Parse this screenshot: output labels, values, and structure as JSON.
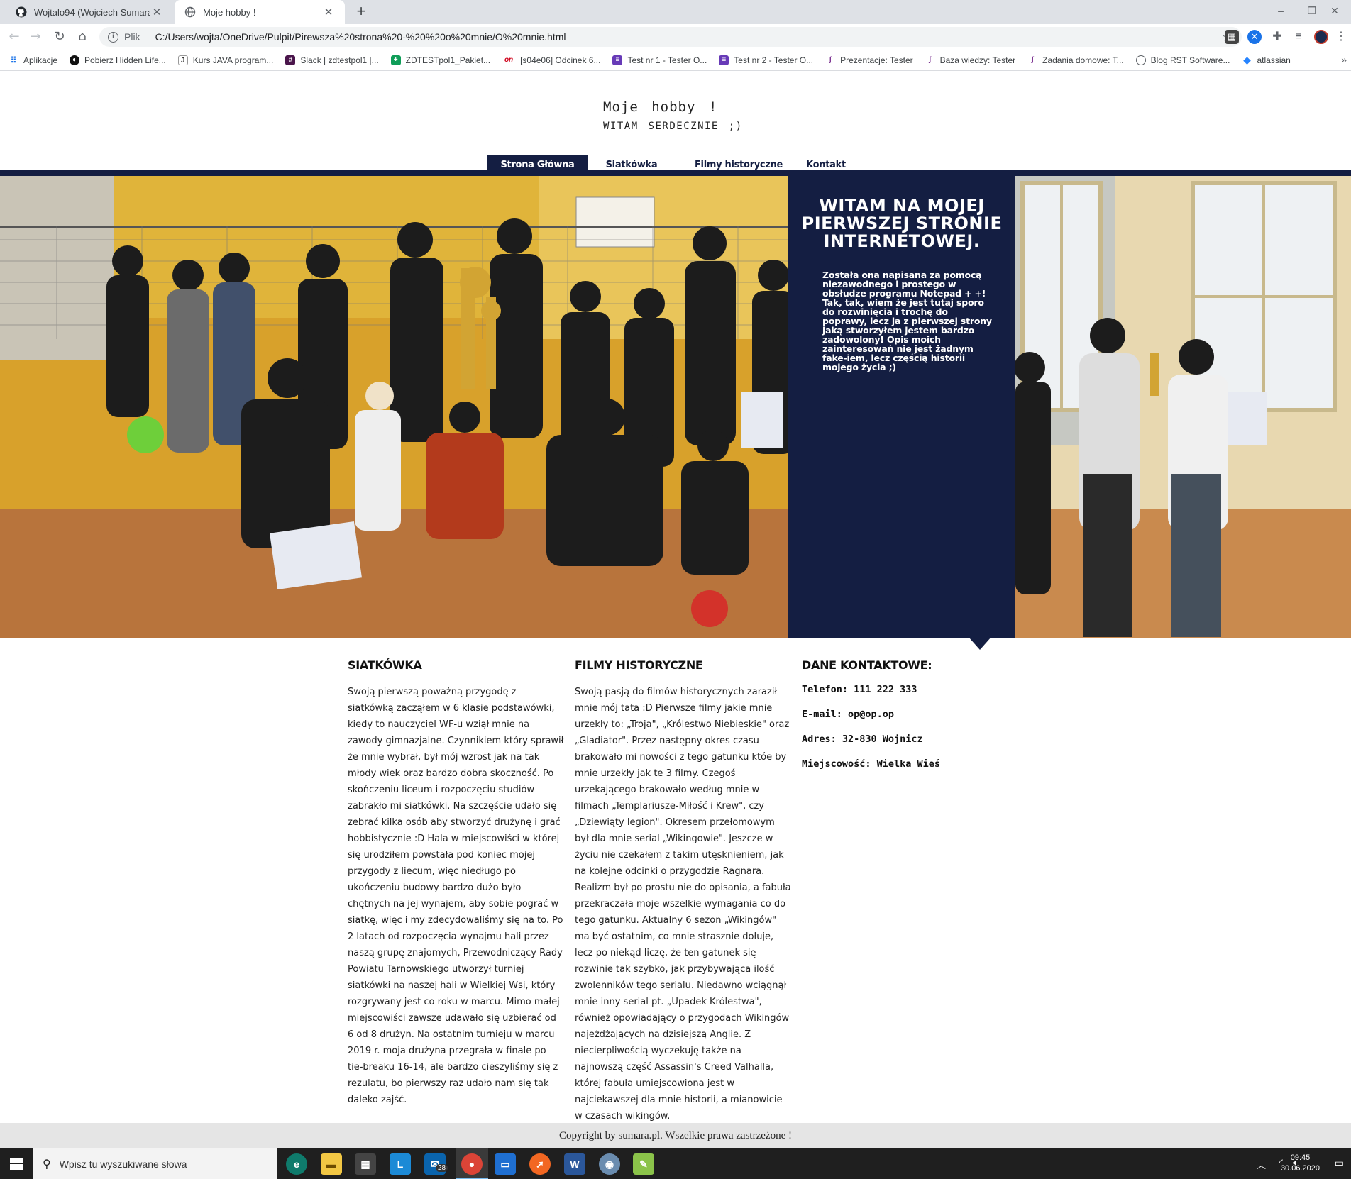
{
  "browser": {
    "tabs": [
      {
        "title": "Wojtalo94 (Wojciech Sumara)",
        "favicon": "github-icon",
        "active": false
      },
      {
        "title": "Moje hobby !",
        "favicon": "globe-icon",
        "active": true
      }
    ],
    "new_tab": "+",
    "window_controls": {
      "minimize": "–",
      "maximize": "❐",
      "close": "✕"
    },
    "address": {
      "scheme": "Plik",
      "url": "C:/Users/wojta/OneDrive/Pulpit/Pirewsza%20strona%20-%20%20o%20mnie/O%20mnie.html"
    },
    "bookmarks": [
      {
        "label": "Aplikacje",
        "icon": "apps-grid-icon"
      },
      {
        "label": "Pobierz Hidden Life...",
        "icon": "hidden-life-icon"
      },
      {
        "label": "Kurs JAVA program...",
        "icon": "java-icon"
      },
      {
        "label": "Slack | zdtestpol1 |...",
        "icon": "slack-icon"
      },
      {
        "label": "ZDTESTpol1_Pakiet...",
        "icon": "sheets-icon"
      },
      {
        "label": "[s04e06] Odcinek 6...",
        "icon": "onet-icon"
      },
      {
        "label": "Test nr 1 - Tester O...",
        "icon": "form-icon"
      },
      {
        "label": "Test nr 2 - Tester O...",
        "icon": "form-icon"
      },
      {
        "label": "Prezentacje: Tester",
        "icon": "moodle-icon"
      },
      {
        "label": "Baza wiedzy: Tester",
        "icon": "moodle-icon"
      },
      {
        "label": "Zadania domowe: T...",
        "icon": "moodle-icon"
      },
      {
        "label": "Blog RST Software...",
        "icon": "globe-icon"
      },
      {
        "label": "atlassian",
        "icon": "atlassian-icon"
      }
    ],
    "bookmarks_more": "»"
  },
  "page": {
    "site_title": "Moje hobby !",
    "site_subtitle": "WITAM SERDECZNIE ;)",
    "nav": [
      {
        "label": "Strona Główna",
        "active": true
      },
      {
        "label": "Siatkówka",
        "active": false
      },
      {
        "label": "Filmy historyczne",
        "active": false
      },
      {
        "label": "Kontakt",
        "active": false
      }
    ],
    "hero": {
      "heading": "WITAM NA MOJEJ PIERWSZEJ STRONIE INTERNETOWEJ.",
      "text": "Została ona napisana za pomocą niezawodnego i prostego w obsłudze programu Notepad + +! Tak, tak, wiem że jest tutaj sporo do rozwinięcia i trochę do poprawy, lecz ja z pierwszej strony jaką stworzyłem jestem bardzo zadowolony! Opis moich zainteresowań nie jest żadnym fake-iem, lecz częścią historii mojego życia ;)"
    },
    "columns": {
      "volleyball": {
        "heading": "SIATKÓWKA",
        "text": "Swoją pierwszą poważną przygodę z siatkówką zacząłem w 6 klasie podstawówki, kiedy to nauczyciel WF-u wziął mnie na zawody gimnazjalne. Czynnikiem który sprawił że mnie wybrał, był mój wzrost jak na tak młody wiek oraz bardzo dobra skoczność. Po skończeniu liceum i rozpoczęciu studiów zabrakło mi siatkówki. Na szczęście udało się zebrać kilka osób aby stworzyć drużynę i grać hobbistycznie :D Hala w miejscowiści w której się urodziłem powstała pod koniec mojej przygody z liecum, więc niedługo po ukończeniu budowy bardzo dużo było chętnych na jej wynajem, aby sobie pograć w siatkę, więc i my zdecydowaliśmy się na to. Po 2 latach od rozpoczęcia wynajmu hali przez naszą grupę znajomych, Przewodniczący Rady Powiatu Tarnowskiego utworzył turniej siatkówki na naszej hali w Wielkiej Wsi, który rozgrywany jest co roku w marcu. Mimo małej miejscowiści zawsze udawało się uzbierać od 6 od 8 drużyn. Na ostatnim turnieju w marcu 2019 r. moja drużyna przegrała w finale po tie-breaku 16-14, ale bardzo cieszyliśmy się z rezulatu, bo pierwszy raz udało nam się tak daleko zajść."
      },
      "movies": {
        "heading": "FILMY HISTORYCZNE",
        "text": "Swoją pasją do filmów historycznych zaraził mnie mój tata :D Pierwsze filmy jakie mnie urzekły to: „Troja\", „Królestwo Niebieskie\" oraz „Gladiator\". Przez następny okres czasu brakowało mi nowości z tego gatunku któe by mnie urzekły jak te 3 filmy. Czegoś urzekającego brakowało według mnie w filmach „Templariusze-Miłość i Krew\", czy „Dziewiąty legion\". Okresem przełomowym był dla mnie serial „Wikingowie\". Jeszcze w życiu nie czekałem z takim utęsknieniem, jak na kolejne odcinki o przygodzie Ragnara. Realizm był po prostu nie do opisania, a fabuła przekraczała moje wszelkie wymagania co do tego gatunku. Aktualny 6 sezon „Wikingów\" ma być ostatnim, co mnie strasznie dołuje, lecz po niekąd liczę, że ten gatunek się rozwinie tak szybko, jak przybywająca ilość zwolenników tego serialu. Niedawno wciągnął mnie inny serial pt. „Upadek Królestwa\", również opowiadający o przygodach Wikingów najeżdżających na dzisiejszą Anglie. Z niecierpliwością wyczekuję także na najnowszą część Assassin's Creed Valhalla, której fabuła umiejscowiona jest w najciekawszej dla mnie historii, a mianowicie w czasach wikingów."
      },
      "contact": {
        "heading": "DANE KONTAKTOWE:",
        "lines": [
          "Telefon: 111 222 333",
          "E-mail: op@op.op",
          "Adres: 32-830 Wojnicz",
          "Miejscowość: Wielka Wieś"
        ]
      }
    },
    "footer": "Copyright by sumara.pl. Wszelkie prawa zastrzeżone !"
  },
  "taskbar": {
    "search_placeholder": "Wpisz tu wyszukiwane słowa",
    "mail_badge": "28",
    "time": "09:45",
    "date": "30.06.2020"
  },
  "colors": {
    "navy": "#141e42",
    "footer_bg": "#e5e5e5"
  }
}
